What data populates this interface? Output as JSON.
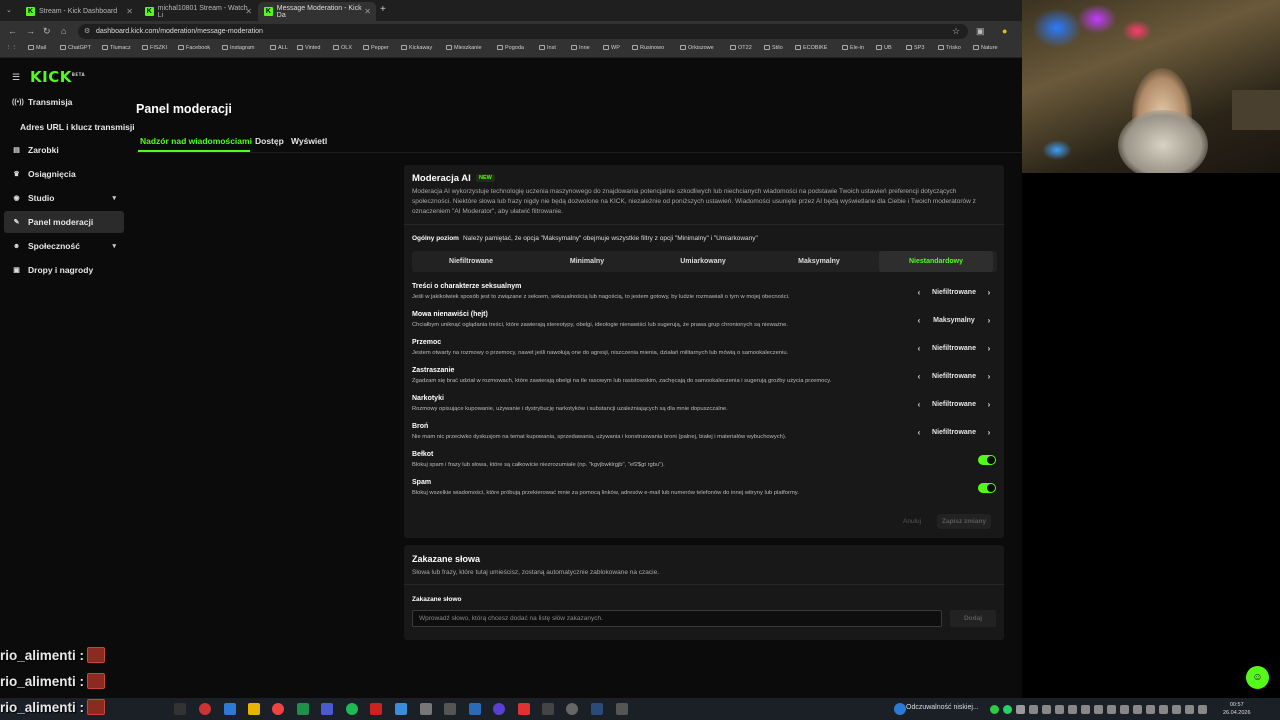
{
  "browser": {
    "tabs": [
      {
        "label": "Stream - Kick Dashboard",
        "active": false
      },
      {
        "label": "michal10801 Stream - Watch Li",
        "active": false
      },
      {
        "label": "Message Moderation - Kick Da",
        "active": true
      }
    ],
    "url": "dashboard.kick.com/moderation/message-moderation",
    "bookmarks": [
      "Mail",
      "ChatGPT",
      "Tłumacz",
      "FISZKI",
      "Facebook",
      "Instagram",
      "ALL",
      "Vinted",
      "OLX",
      "Pepper",
      "Kickaway",
      "Mieszkanie",
      "Pogoda",
      "Inst",
      "Inne",
      "WP",
      "Rusinowo",
      "Orkiszowe",
      "OT22",
      "Stilo",
      "ECOBIKE",
      "Ele-in",
      "UB",
      "SP3",
      "Trisko",
      "Nature"
    ]
  },
  "kick": {
    "logo": "KICK",
    "logo_badge": "BETA",
    "sidebar": [
      {
        "label": "Transmisja",
        "icon": "broadcast-icon"
      },
      {
        "label": "Adres URL i klucz transmisji",
        "icon": ""
      },
      {
        "label": "Zarobki",
        "icon": "money-icon"
      },
      {
        "label": "Osiągnięcia",
        "icon": "trophy-icon"
      },
      {
        "label": "Studio",
        "icon": "studio-icon"
      },
      {
        "label": "Panel moderacji",
        "icon": "wrench-icon"
      },
      {
        "label": "Społeczność",
        "icon": "people-icon"
      },
      {
        "label": "Dropy i nagrody",
        "icon": "gift-icon"
      }
    ],
    "page_title": "Panel moderacji",
    "tabs": [
      "Nadzór nad wiadomościami",
      "Dostęp",
      "Wyświetl"
    ],
    "ai": {
      "title": "Moderacja AI",
      "badge": "NEW",
      "description": "Moderacja AI wykorzystuje technologię uczenia maszynowego do znajdowania potencjalnie szkodliwych lub niechcianych wiadomości na podstawie Twoich ustawień preferencji dotyczących społeczności. Niektóre słowa lub frazy nigdy nie będą dozwolone na KICK, niezależnie od poniższych ustawień. Wiadomości usunięte przez AI będą wyświetlane dla Ciebie i Twoich moderatorów z oznaczeniem \"AI Moderator\", aby ułatwić filtrowanie.",
      "level_label": "Ogólny poziom",
      "level_note": "Należy pamiętać, że opcja \"Maksymalny\" obejmuje wszystkie filtry z opcji \"Minimalny\" i \"Umiarkowany\"",
      "levels": [
        "Niefiltrowane",
        "Minimalny",
        "Umiarkowany",
        "Maksymalny",
        "Niestandardowy"
      ],
      "active_level": "Niestandardowy",
      "categories": [
        {
          "title": "Treści o charakterze seksualnym",
          "desc": "Jeśli w jakikolwiek sposób jest to związane z seksem, seksualnością lub nagością, to jestem gotowy, by ludzie rozmawiali o tym w mojej obecności.",
          "value": "Niefiltrowane"
        },
        {
          "title": "Mowa nienawiści (hejt)",
          "desc": "Chciałbym uniknąć oglądania treści, które zawierają stereotypy, obelgi, ideologie nienawiści lub sugerują, że prawa grup chronionych są nieważne.",
          "value": "Maksymalny"
        },
        {
          "title": "Przemoc",
          "desc": "Jestem otwarty na rozmowy o przemocy, nawet jeśli nawołują one do agresji, niszczenia mienia, działań militarnych lub mówią o samookaleczeniu.",
          "value": "Niefiltrowane"
        },
        {
          "title": "Zastraszanie",
          "desc": "Zgadzam się brać udział w rozmowach, które zawierają obelgi na tle rasowym lub rasistowskim, zachęcają do samookaleczenia i sugerują groźby użycia przemocy.",
          "value": "Niefiltrowane"
        },
        {
          "title": "Narkotyki",
          "desc": "Rozmowy opisujące kupowanie, używanie i dystrybucję narkotyków i substancji uzależniających są dla mnie dopuszczalne.",
          "value": "Niefiltrowane"
        },
        {
          "title": "Broń",
          "desc": "Nie mam nic przeciwko dyskusjom na temat kupowania, sprzedawania, używania i konstruowania broni (palnej, białej i materiałów wybuchowych).",
          "value": "Niefiltrowane"
        }
      ],
      "toggles": [
        {
          "title": "Bełkot",
          "desc": "Blokuj spam i frazy lub słowa, które są całkowicie niezrozumiałe (np. \"kgvjbwklrgjb\", \"ef2$gt rgbu\").",
          "on": true
        },
        {
          "title": "Spam",
          "desc": "Blokuj wszelkie wiadomości, które próbują przekierować mnie za pomocą linków, adresów e-mail lub numerów telefonów do innej witryny lub platformy.",
          "on": true
        }
      ],
      "cancel": "Anuluj",
      "save": "Zapisz zmiany"
    },
    "banned": {
      "title": "Zakazane słowa",
      "desc": "Słowa lub frazy, które tutaj umieścisz, zostaną automatycznie zablokowane na czacie.",
      "field_label": "Zakazane słowo",
      "placeholder": "Wprowadź słowo, którą chcesz dodać na listę słów zakazanych.",
      "add": "Dodaj"
    }
  },
  "overlay_chat": [
    "rio_alimenti :",
    "rio_alimenti :",
    "rio_alimenti :"
  ],
  "taskbar": {
    "notification": "Odczuwalność niskiej...",
    "time": "00:57",
    "date": "26.04.2026"
  },
  "colors": {
    "accent": "#53fc18",
    "panel": "#181818",
    "bg": "#0b0b0b"
  }
}
